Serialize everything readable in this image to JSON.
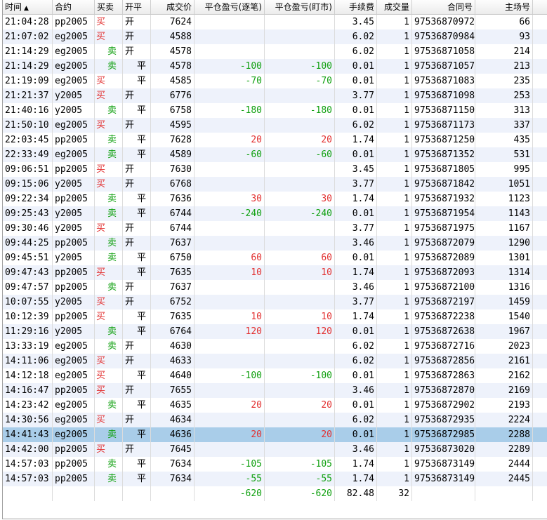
{
  "columns": {
    "time": "时间",
    "contract": "合约",
    "bs": "买卖",
    "oc": "开平",
    "price": "成交价",
    "pnl_trade": "平仓盈亏(逐笔)",
    "pnl_mark": "平仓盈亏(盯市)",
    "fee": "手续费",
    "volume": "成交量",
    "order_no": "合同号",
    "ref_no": "主场号"
  },
  "sort_icon": "▲",
  "colors": {
    "buy": "#e23030",
    "sell": "#10a010",
    "selected_row": "#a9cde9",
    "alt_row": "#eef2fb"
  },
  "rows": [
    {
      "time": "21:04:28",
      "contract": "pp2005",
      "bs": "买",
      "oc": "开",
      "price": "7624",
      "pnl1": "",
      "pnl2": "",
      "fee": "3.45",
      "vol": "1",
      "order": "97536870972",
      "ref": "66"
    },
    {
      "time": "21:07:02",
      "contract": "eg2005",
      "bs": "买",
      "oc": "开",
      "price": "4588",
      "pnl1": "",
      "pnl2": "",
      "fee": "6.02",
      "vol": "1",
      "order": "97536870984",
      "ref": "93"
    },
    {
      "time": "21:14:29",
      "contract": "eg2005",
      "bs": "卖",
      "oc": "开",
      "price": "4578",
      "pnl1": "",
      "pnl2": "",
      "fee": "6.02",
      "vol": "1",
      "order": "97536871058",
      "ref": "214"
    },
    {
      "time": "21:14:29",
      "contract": "eg2005",
      "bs": "卖",
      "oc": "平",
      "price": "4578",
      "pnl1": "-100",
      "pnl2": "-100",
      "fee": "0.01",
      "vol": "1",
      "order": "97536871057",
      "ref": "213"
    },
    {
      "time": "21:19:09",
      "contract": "eg2005",
      "bs": "买",
      "oc": "平",
      "price": "4585",
      "pnl1": "-70",
      "pnl2": "-70",
      "fee": "0.01",
      "vol": "1",
      "order": "97536871083",
      "ref": "235"
    },
    {
      "time": "21:21:37",
      "contract": "y2005",
      "bs": "买",
      "oc": "开",
      "price": "6776",
      "pnl1": "",
      "pnl2": "",
      "fee": "3.77",
      "vol": "1",
      "order": "97536871098",
      "ref": "253"
    },
    {
      "time": "21:40:16",
      "contract": "y2005",
      "bs": "卖",
      "oc": "平",
      "price": "6758",
      "pnl1": "-180",
      "pnl2": "-180",
      "fee": "0.01",
      "vol": "1",
      "order": "97536871150",
      "ref": "313"
    },
    {
      "time": "21:50:10",
      "contract": "eg2005",
      "bs": "买",
      "oc": "开",
      "price": "4595",
      "pnl1": "",
      "pnl2": "",
      "fee": "6.02",
      "vol": "1",
      "order": "97536871173",
      "ref": "337"
    },
    {
      "time": "22:03:45",
      "contract": "pp2005",
      "bs": "卖",
      "oc": "平",
      "price": "7628",
      "pnl1": "20",
      "pnl2": "20",
      "fee": "1.74",
      "vol": "1",
      "order": "97536871250",
      "ref": "435"
    },
    {
      "time": "22:33:49",
      "contract": "eg2005",
      "bs": "卖",
      "oc": "平",
      "price": "4589",
      "pnl1": "-60",
      "pnl2": "-60",
      "fee": "0.01",
      "vol": "1",
      "order": "97536871352",
      "ref": "531"
    },
    {
      "time": "09:06:51",
      "contract": "pp2005",
      "bs": "买",
      "oc": "开",
      "price": "7630",
      "pnl1": "",
      "pnl2": "",
      "fee": "3.45",
      "vol": "1",
      "order": "97536871805",
      "ref": "995"
    },
    {
      "time": "09:15:06",
      "contract": "y2005",
      "bs": "买",
      "oc": "开",
      "price": "6768",
      "pnl1": "",
      "pnl2": "",
      "fee": "3.77",
      "vol": "1",
      "order": "97536871842",
      "ref": "1051"
    },
    {
      "time": "09:22:34",
      "contract": "pp2005",
      "bs": "卖",
      "oc": "平",
      "price": "7636",
      "pnl1": "30",
      "pnl2": "30",
      "fee": "1.74",
      "vol": "1",
      "order": "97536871932",
      "ref": "1123"
    },
    {
      "time": "09:25:43",
      "contract": "y2005",
      "bs": "卖",
      "oc": "平",
      "price": "6744",
      "pnl1": "-240",
      "pnl2": "-240",
      "fee": "0.01",
      "vol": "1",
      "order": "97536871954",
      "ref": "1143"
    },
    {
      "time": "09:30:46",
      "contract": "y2005",
      "bs": "买",
      "oc": "开",
      "price": "6744",
      "pnl1": "",
      "pnl2": "",
      "fee": "3.77",
      "vol": "1",
      "order": "97536871975",
      "ref": "1167"
    },
    {
      "time": "09:44:25",
      "contract": "pp2005",
      "bs": "卖",
      "oc": "开",
      "price": "7637",
      "pnl1": "",
      "pnl2": "",
      "fee": "3.46",
      "vol": "1",
      "order": "97536872079",
      "ref": "1290"
    },
    {
      "time": "09:45:51",
      "contract": "y2005",
      "bs": "卖",
      "oc": "平",
      "price": "6750",
      "pnl1": "60",
      "pnl2": "60",
      "fee": "0.01",
      "vol": "1",
      "order": "97536872089",
      "ref": "1301"
    },
    {
      "time": "09:47:43",
      "contract": "pp2005",
      "bs": "买",
      "oc": "平",
      "price": "7635",
      "pnl1": "10",
      "pnl2": "10",
      "fee": "1.74",
      "vol": "1",
      "order": "97536872093",
      "ref": "1314"
    },
    {
      "time": "09:47:57",
      "contract": "pp2005",
      "bs": "卖",
      "oc": "开",
      "price": "7637",
      "pnl1": "",
      "pnl2": "",
      "fee": "3.46",
      "vol": "1",
      "order": "97536872100",
      "ref": "1316"
    },
    {
      "time": "10:07:55",
      "contract": "y2005",
      "bs": "买",
      "oc": "开",
      "price": "6752",
      "pnl1": "",
      "pnl2": "",
      "fee": "3.77",
      "vol": "1",
      "order": "97536872197",
      "ref": "1459"
    },
    {
      "time": "10:12:39",
      "contract": "pp2005",
      "bs": "买",
      "oc": "平",
      "price": "7635",
      "pnl1": "10",
      "pnl2": "10",
      "fee": "1.74",
      "vol": "1",
      "order": "97536872238",
      "ref": "1540"
    },
    {
      "time": "11:29:16",
      "contract": "y2005",
      "bs": "卖",
      "oc": "平",
      "price": "6764",
      "pnl1": "120",
      "pnl2": "120",
      "fee": "0.01",
      "vol": "1",
      "order": "97536872638",
      "ref": "1967"
    },
    {
      "time": "13:33:19",
      "contract": "eg2005",
      "bs": "卖",
      "oc": "开",
      "price": "4630",
      "pnl1": "",
      "pnl2": "",
      "fee": "6.02",
      "vol": "1",
      "order": "97536872716",
      "ref": "2023"
    },
    {
      "time": "14:11:06",
      "contract": "eg2005",
      "bs": "买",
      "oc": "开",
      "price": "4633",
      "pnl1": "",
      "pnl2": "",
      "fee": "6.02",
      "vol": "1",
      "order": "97536872856",
      "ref": "2161"
    },
    {
      "time": "14:12:18",
      "contract": "eg2005",
      "bs": "买",
      "oc": "平",
      "price": "4640",
      "pnl1": "-100",
      "pnl2": "-100",
      "fee": "0.01",
      "vol": "1",
      "order": "97536872863",
      "ref": "2162"
    },
    {
      "time": "14:16:47",
      "contract": "pp2005",
      "bs": "买",
      "oc": "开",
      "price": "7655",
      "pnl1": "",
      "pnl2": "",
      "fee": "3.46",
      "vol": "1",
      "order": "97536872870",
      "ref": "2169"
    },
    {
      "time": "14:23:42",
      "contract": "eg2005",
      "bs": "卖",
      "oc": "平",
      "price": "4635",
      "pnl1": "20",
      "pnl2": "20",
      "fee": "0.01",
      "vol": "1",
      "order": "97536872902",
      "ref": "2193"
    },
    {
      "time": "14:30:56",
      "contract": "eg2005",
      "bs": "买",
      "oc": "开",
      "price": "4634",
      "pnl1": "",
      "pnl2": "",
      "fee": "6.02",
      "vol": "1",
      "order": "97536872935",
      "ref": "2224"
    },
    {
      "time": "14:41:43",
      "contract": "eg2005",
      "bs": "卖",
      "oc": "平",
      "price": "4636",
      "pnl1": "20",
      "pnl2": "20",
      "fee": "0.01",
      "vol": "1",
      "order": "97536872985",
      "ref": "2288",
      "selected": true
    },
    {
      "time": "14:42:00",
      "contract": "pp2005",
      "bs": "买",
      "oc": "开",
      "price": "7645",
      "pnl1": "",
      "pnl2": "",
      "fee": "3.46",
      "vol": "1",
      "order": "97536873020",
      "ref": "2289"
    },
    {
      "time": "14:57:03",
      "contract": "pp2005",
      "bs": "卖",
      "oc": "平",
      "price": "7634",
      "pnl1": "-105",
      "pnl2": "-105",
      "fee": "1.74",
      "vol": "1",
      "order": "97536873149",
      "ref": "2444"
    },
    {
      "time": "14:57:03",
      "contract": "pp2005",
      "bs": "卖",
      "oc": "平",
      "price": "7634",
      "pnl1": "-55",
      "pnl2": "-55",
      "fee": "1.74",
      "vol": "1",
      "order": "97536873149",
      "ref": "2445"
    }
  ],
  "totals": {
    "pnl1": "-620",
    "pnl2": "-620",
    "fee": "82.48",
    "vol": "32"
  }
}
